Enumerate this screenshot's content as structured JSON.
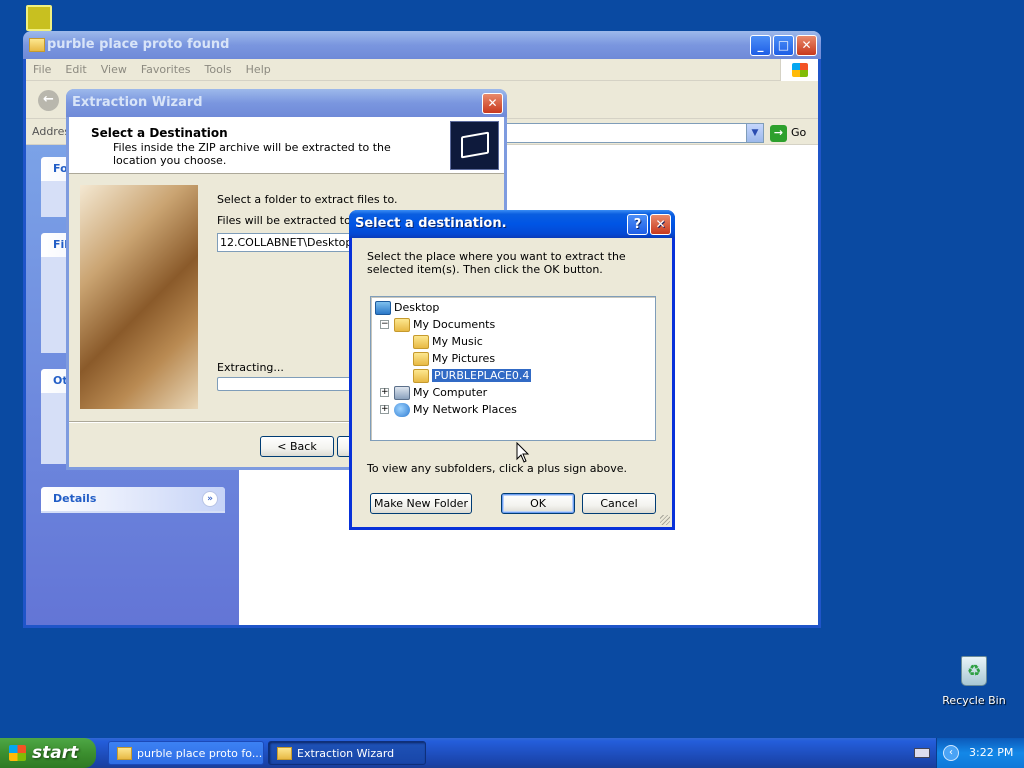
{
  "desktop": {
    "recycle_bin_label": "Recycle Bin"
  },
  "explorer": {
    "title": "purble place proto found",
    "menu": [
      "File",
      "Edit",
      "View",
      "Favorites",
      "Tools",
      "Help"
    ],
    "address_label": "Address",
    "go_label": "Go",
    "details_label": "Details"
  },
  "wizard": {
    "title": "Extraction Wizard",
    "heading": "Select a Destination",
    "subheading": "Files inside the ZIP archive will be extracted to the location you choose.",
    "select_folder_text": "Select a folder to extract files to.",
    "extract_to_text": "Files will be extracted to this",
    "path_value": "12.COLLABNET\\Desktop\\p",
    "extracting_text": "Extracting...",
    "back_label": "< Back"
  },
  "dialog": {
    "title": "Select a destination.",
    "help_label": "?",
    "instruction": "Select the place where you want to extract the selected item(s).  Then click the OK button.",
    "tree": [
      {
        "label": "Desktop"
      },
      {
        "label": "My Documents"
      },
      {
        "label": "My Music"
      },
      {
        "label": "My Pictures"
      },
      {
        "label": "PURBLEPLACE0.4"
      },
      {
        "label": "My Computer"
      },
      {
        "label": "My Network Places"
      }
    ],
    "hint": "To view any subfolders, click a plus sign above.",
    "make_new_folder_label": "Make New Folder",
    "ok_label": "OK",
    "cancel_label": "Cancel"
  },
  "taskbar": {
    "start_label": "start",
    "items": [
      {
        "label": "purble place proto fo..."
      },
      {
        "label": "Extraction Wizard"
      }
    ],
    "clock": "3:22 PM"
  }
}
